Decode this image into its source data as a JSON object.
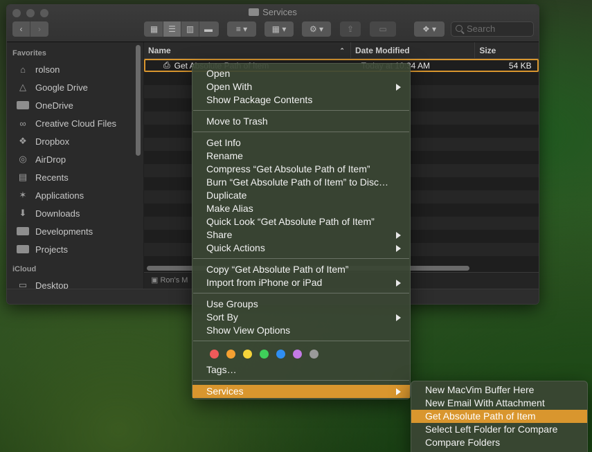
{
  "window": {
    "title": "Services",
    "toolbar": {
      "back_icon": "chevron-left",
      "forward_icon": "chevron-right",
      "view_icons": [
        "icon-view",
        "list-view",
        "column-view",
        "gallery-view"
      ],
      "group_icon": "group-menu",
      "grid_icon": "arrange-menu",
      "action_icon": "gear",
      "share_icon": "share",
      "tag_icon": "tag",
      "dropbox_icon": "dropbox",
      "search_placeholder": "Search"
    }
  },
  "sidebar": {
    "sections": [
      {
        "title": "Favorites",
        "items": [
          {
            "label": "rolson",
            "icon": "home-icon"
          },
          {
            "label": "Google Drive",
            "icon": "google-drive-icon"
          },
          {
            "label": "OneDrive",
            "icon": "folder-icon"
          },
          {
            "label": "Creative Cloud Files",
            "icon": "creative-cloud-icon"
          },
          {
            "label": "Dropbox",
            "icon": "dropbox-icon"
          },
          {
            "label": "AirDrop",
            "icon": "airdrop-icon"
          },
          {
            "label": "Recents",
            "icon": "recents-icon"
          },
          {
            "label": "Applications",
            "icon": "applications-icon"
          },
          {
            "label": "Downloads",
            "icon": "downloads-icon"
          },
          {
            "label": "Developments",
            "icon": "folder-icon"
          },
          {
            "label": "Projects",
            "icon": "folder-icon"
          }
        ]
      },
      {
        "title": "iCloud",
        "items": [
          {
            "label": "Desktop",
            "icon": "desktop-icon"
          }
        ]
      }
    ]
  },
  "list": {
    "columns": {
      "name": "Name",
      "date_modified": "Date Modified",
      "size": "Size"
    },
    "selected_row": {
      "name": "Get Absolute Path of Item",
      "date": "Today at 10:34 AM",
      "size": "54 KB"
    },
    "path_bar": "Ron's M"
  },
  "context_menu": {
    "groups": [
      [
        {
          "label": "Open"
        },
        {
          "label": "Open With",
          "submenu": true
        },
        {
          "label": "Show Package Contents"
        }
      ],
      [
        {
          "label": "Move to Trash"
        }
      ],
      [
        {
          "label": "Get Info"
        },
        {
          "label": "Rename"
        },
        {
          "label": "Compress “Get Absolute Path of Item”"
        },
        {
          "label": "Burn “Get Absolute Path of Item” to Disc…"
        },
        {
          "label": "Duplicate"
        },
        {
          "label": "Make Alias"
        },
        {
          "label": "Quick Look “Get Absolute Path of Item”"
        },
        {
          "label": "Share",
          "submenu": true
        },
        {
          "label": "Quick Actions",
          "submenu": true
        }
      ],
      [
        {
          "label": "Copy “Get Absolute Path of Item”"
        },
        {
          "label": "Import from iPhone or iPad",
          "submenu": true
        }
      ],
      [
        {
          "label": "Use Groups"
        },
        {
          "label": "Sort By",
          "submenu": true
        },
        {
          "label": "Show View Options"
        }
      ]
    ],
    "tag_colors": [
      "#f05a5a",
      "#f5a031",
      "#f5d33a",
      "#3fcf5a",
      "#2f8ef2",
      "#c47ae6",
      "#9a9a9a"
    ],
    "tags_label": "Tags…",
    "services_label": "Services"
  },
  "services_submenu": {
    "items": [
      {
        "label": "New MacVim Buffer Here"
      },
      {
        "label": "New Email With Attachment"
      },
      {
        "label": "Get Absolute Path of Item",
        "highlighted": true
      },
      {
        "label": "Select Left Folder for Compare"
      },
      {
        "label": "Compare Folders"
      }
    ]
  },
  "colors": {
    "accent": "#d9962e",
    "menu_bg": "#3a4634",
    "window_bg": "#1f1f1f"
  }
}
